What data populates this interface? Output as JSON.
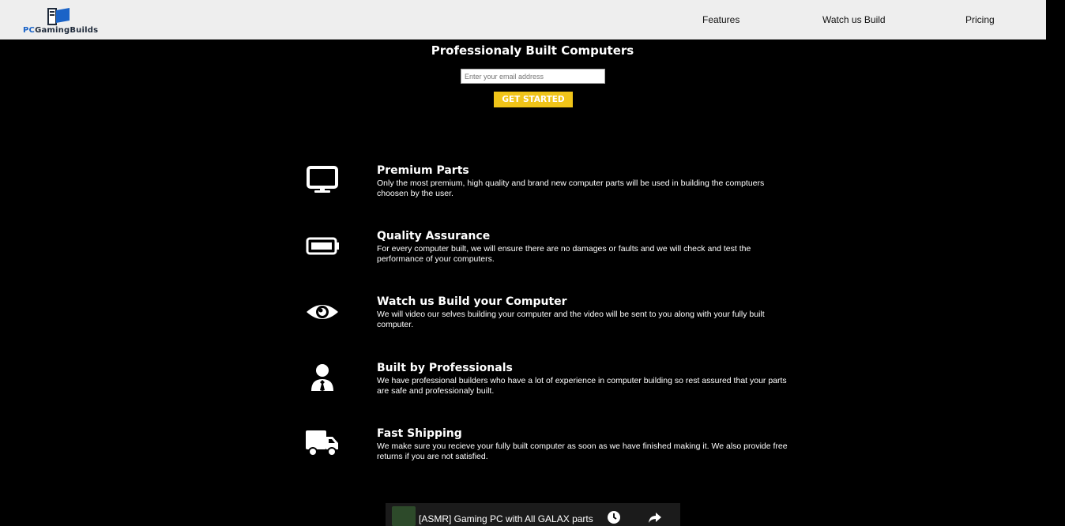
{
  "header": {
    "logo_text_pc": "PC",
    "logo_text_rest": "GamingBuilds",
    "nav": [
      {
        "label": "Features"
      },
      {
        "label": "Watch us Build"
      },
      {
        "label": "Pricing"
      }
    ]
  },
  "hero": {
    "title": "Professionaly Built Computers",
    "email_placeholder": "Enter your email address",
    "cta_label": "GET STARTED"
  },
  "features": [
    {
      "icon": "monitor-icon",
      "title": "Premium Parts",
      "text": "Only the most premium, high quality and brand new computer parts will be used in building the comptuers choosen by the user."
    },
    {
      "icon": "battery-icon",
      "title": "Quality Assurance",
      "text": "For every computer built, we will ensure there are no damages or faults and we will check and test the performance of your computers."
    },
    {
      "icon": "eye-icon",
      "title": "Watch us Build your Computer",
      "text": "We will video our selves building your computer and the video will be sent to you along with your fully built computer."
    },
    {
      "icon": "user-tie-icon",
      "title": "Built by Professionals",
      "text": "We have professional builders who have a lot of experience in computer building so rest assured that your parts are safe and professionaly built."
    },
    {
      "icon": "truck-icon",
      "title": "Fast Shipping",
      "text": "We make sure you recieve your fully built computer as soon as we have finished making it. We also provide free returns if you are not satisfied."
    }
  ],
  "video": {
    "title": "[ASMR] Gaming PC with All GALAX parts"
  },
  "colors": {
    "header_bg": "#eeeeee",
    "page_bg": "#000000",
    "cta_bg": "#f0c419",
    "logo_blue": "#1a63c7"
  }
}
